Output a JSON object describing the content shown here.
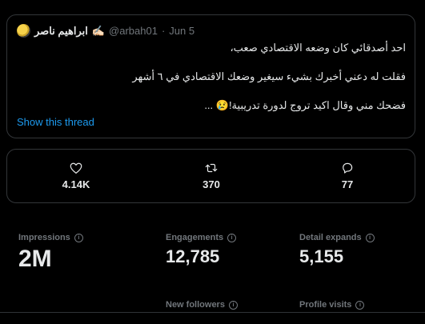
{
  "tweet": {
    "display_name": "ابراهيم ناصر",
    "name_emoji": "✍🏻",
    "handle": "@arbah01",
    "separator": "·",
    "date": "Jun 5",
    "lines": [
      "احد أصدقائي كان وضعه الاقتصادي صعب،",
      "فقلت له دعني أخبرك بشيء سيغير وضعك الاقتصادي في ٦ أشهر",
      "فضحك مني وقال اكيد تروج لدورة تدريبية!😢 ..."
    ],
    "show_thread": "Show this thread"
  },
  "stats": {
    "likes": "4.14K",
    "retweets": "370",
    "replies": "77"
  },
  "metrics": {
    "impressions_label": "Impressions",
    "impressions_value": "2M",
    "engagements_label": "Engagements",
    "engagements_value": "12,785",
    "detail_expands_label": "Detail expands",
    "detail_expands_value": "5,155",
    "new_followers_label": "New followers",
    "profile_visits_label": "Profile visits"
  },
  "icons": {
    "like": "heart-icon",
    "retweet": "retweet-icon",
    "reply": "reply-icon",
    "info": "info-icon"
  },
  "colors": {
    "background": "#000000",
    "text": "#e7e9ea",
    "muted": "#71767b",
    "link": "#1d9bf0",
    "border": "#333639"
  }
}
